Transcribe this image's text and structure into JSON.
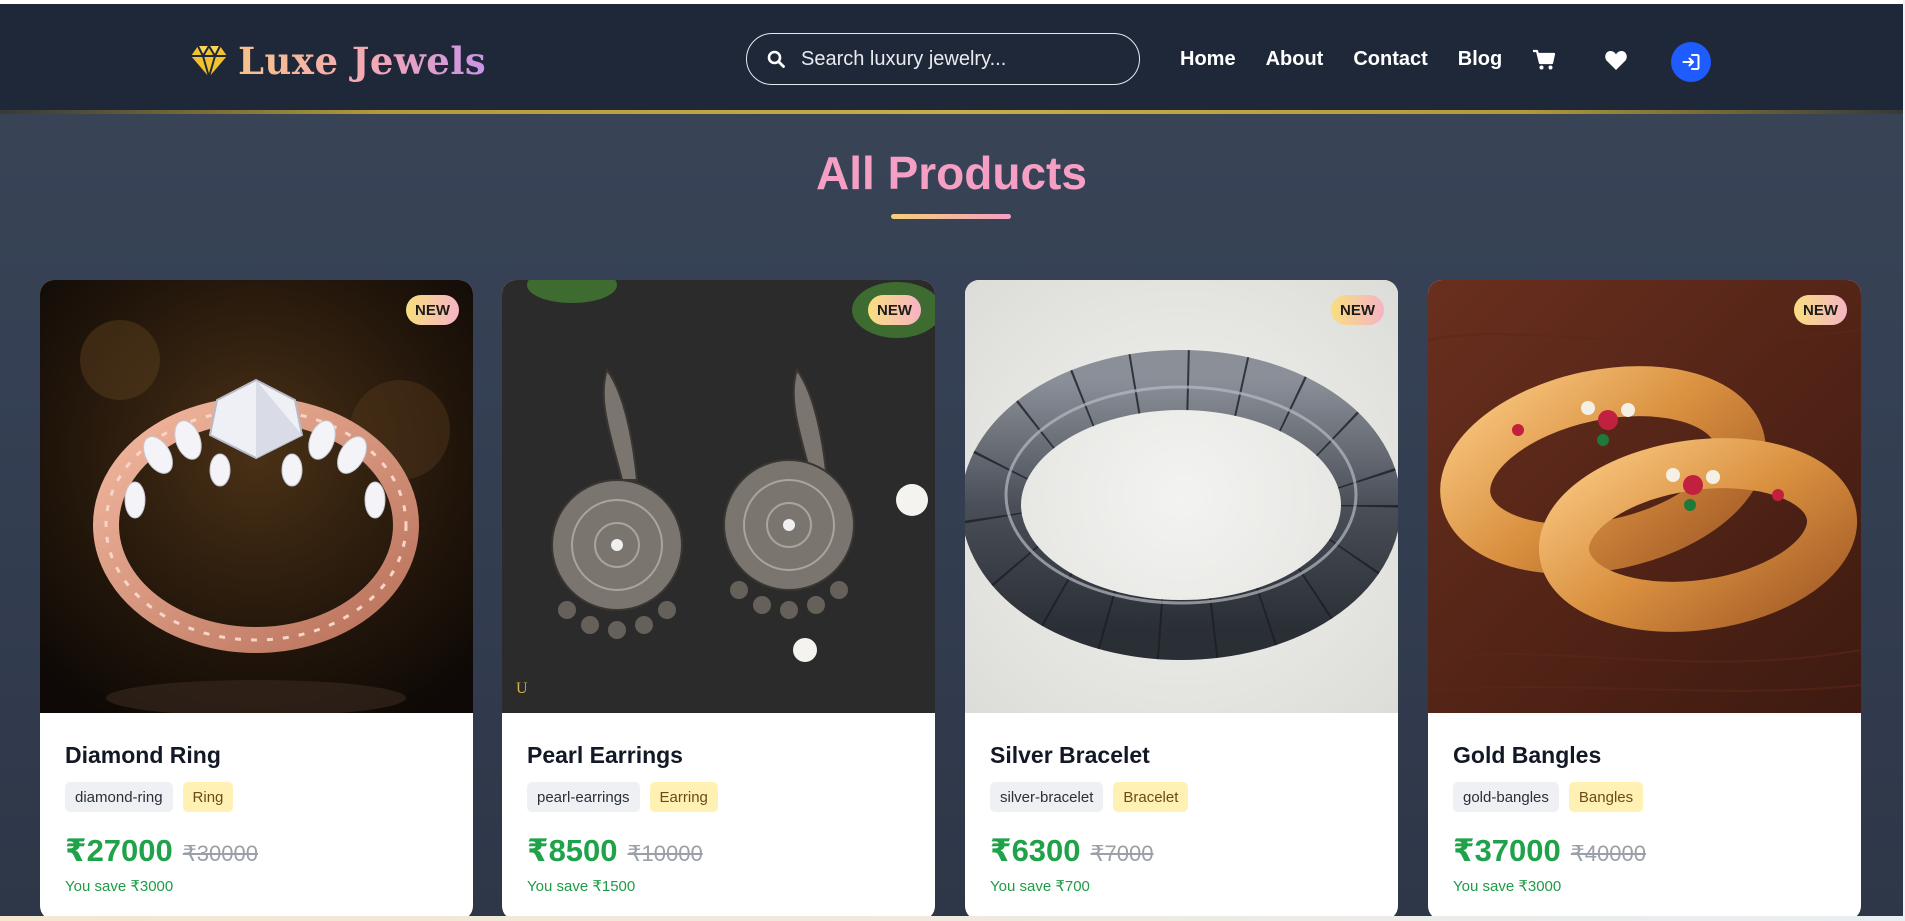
{
  "brand": {
    "name": "Luxe Jewels",
    "icon": "diamond-icon",
    "gradient": [
      "#f6c28b",
      "#f3a8b6",
      "#c894e6"
    ]
  },
  "search": {
    "placeholder": "Search luxury jewelry...",
    "value": ""
  },
  "nav": {
    "links": [
      "Home",
      "About",
      "Contact",
      "Blog"
    ],
    "icons": [
      "cart-icon",
      "heart-icon",
      "login-icon"
    ]
  },
  "section": {
    "title": "All Products"
  },
  "colors": {
    "navbar": "#1f2839",
    "accent_gold": "#c9ad45",
    "title_pink": "#f49fc3",
    "price_green": "#1fa24a",
    "login_blue": "#1f5cff"
  },
  "products": [
    {
      "badge": "NEW",
      "name": "Diamond Ring",
      "tags": [
        "diamond-ring",
        "Ring"
      ],
      "price": "₹27000",
      "old_price": "₹30000",
      "save": "You save ₹3000"
    },
    {
      "badge": "NEW",
      "name": "Pearl Earrings",
      "tags": [
        "pearl-earrings",
        "Earring"
      ],
      "price": "₹8500",
      "old_price": "₹10000",
      "save": "You save ₹1500"
    },
    {
      "badge": "NEW",
      "name": "Silver Bracelet",
      "tags": [
        "silver-bracelet",
        "Bracelet"
      ],
      "price": "₹6300",
      "old_price": "₹7000",
      "save": "You save ₹700"
    },
    {
      "badge": "NEW",
      "name": "Gold Bangles",
      "tags": [
        "gold-bangles",
        "Bangles"
      ],
      "price": "₹37000",
      "old_price": "₹40000",
      "save": "You save ₹3000"
    }
  ]
}
